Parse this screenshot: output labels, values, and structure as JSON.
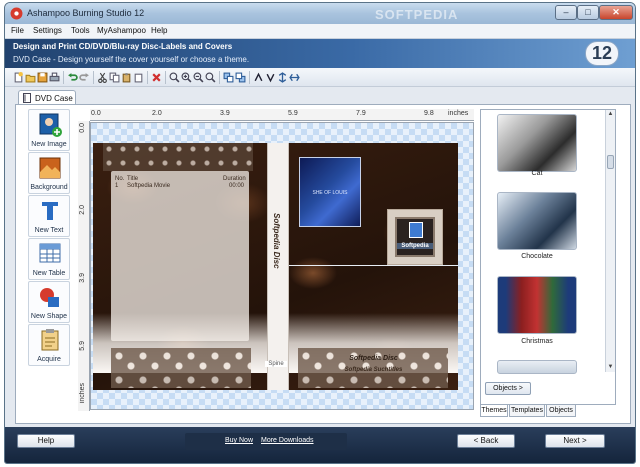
{
  "window": {
    "title": "Ashampoo Burning Studio 12",
    "watermark": "SOFTPEDIA",
    "controls": {
      "minimize": "–",
      "maximize": "□",
      "close": "✕"
    }
  },
  "menu": [
    "File",
    "Settings",
    "Tools",
    "MyAshampoo",
    "Help"
  ],
  "banner": {
    "title": "Design and Print CD/DVD/Blu-ray Disc-Labels and Covers",
    "subtitle": "DVD Case - Design yourself the cover yourself or choose a theme.",
    "version": "12"
  },
  "doc_tab": {
    "label": "DVD Case"
  },
  "tools": [
    {
      "label": "New Image",
      "icon": "new-image-icon"
    },
    {
      "label": "Background",
      "icon": "background-icon"
    },
    {
      "label": "New Text",
      "icon": "new-text-icon"
    },
    {
      "label": "New Table",
      "icon": "new-table-icon"
    },
    {
      "label": "New Shape",
      "icon": "new-shape-icon"
    },
    {
      "label": "Acquire",
      "icon": "acquire-icon"
    }
  ],
  "ruler": {
    "h_labels": [
      "0.0",
      "2.0",
      "3.9",
      "5.9",
      "7.9",
      "9.8",
      "inches"
    ],
    "v_labels": [
      "0.0",
      "2.0",
      "3.9",
      "5.9"
    ],
    "unit_v": "inches"
  },
  "cover": {
    "back_headers": {
      "no": "No.",
      "title": "Title",
      "duration": "Duration"
    },
    "back_row": {
      "no": "1",
      "title": "Softpedia Movie",
      "duration": "00:00"
    },
    "spine_text": "Softpedia Disc",
    "spine_label": "Spine",
    "photo_text": "SHE OF LOUIS",
    "badge_text": "Softpedia",
    "front_title": "Softpedia Disc",
    "front_subtitle": "Softpedia Suchtitles"
  },
  "themes": [
    {
      "label": "Cat",
      "colors": [
        "#d9d9d9",
        "#2a2a2a"
      ]
    },
    {
      "label": "Chocolate",
      "colors": [
        "#5b6f86",
        "#cfd8e3"
      ]
    },
    {
      "label": "Christmas",
      "colors": [
        "#8b1f1f",
        "#2f6a3a"
      ]
    }
  ],
  "panel": {
    "objects_button": "Objects >",
    "tabs": [
      "Themes",
      "Templates",
      "Objects"
    ]
  },
  "footer": {
    "help": "Help",
    "buy_now": "Buy Now",
    "more_downloads": "More Downloads",
    "back": "< Back",
    "next": "Next >"
  }
}
